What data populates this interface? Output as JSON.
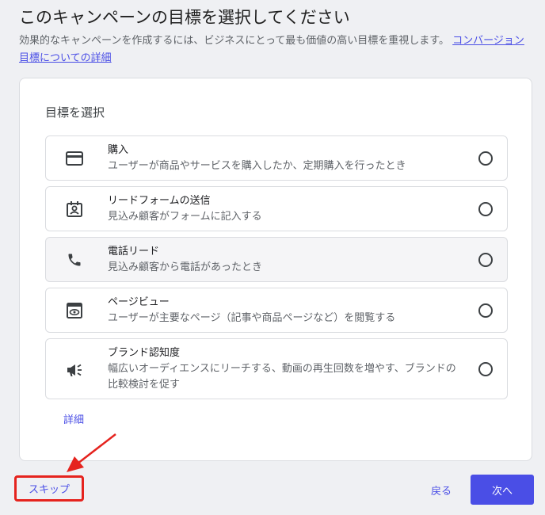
{
  "header": {
    "title": "このキャンペーンの目標を選択してください",
    "description": "効果的なキャンペーンを作成するには、ビジネスにとって最も価値の高い目標を重視します。",
    "link_label": "コンバージョン目標についての詳細"
  },
  "card": {
    "heading": "目標を選択",
    "options": [
      {
        "title": "購入",
        "desc": "ユーザーが商品やサービスを購入したか、定期購入を行ったとき",
        "icon": "credit-card-icon"
      },
      {
        "title": "リードフォームの送信",
        "desc": "見込み顧客がフォームに記入する",
        "icon": "contact-form-icon"
      },
      {
        "title": "電話リード",
        "desc": "見込み顧客から電話があったとき",
        "icon": "phone-icon"
      },
      {
        "title": "ページビュー",
        "desc": "ユーザーが主要なページ（記事や商品ページなど）を閲覧する",
        "icon": "pageview-icon"
      },
      {
        "title": "ブランド認知度",
        "desc": "幅広いオーディエンスにリーチする、動画の再生回数を増やす、ブランドの比較検討を促す",
        "icon": "megaphone-icon"
      }
    ],
    "more_link": "詳細"
  },
  "footer": {
    "skip_label": "スキップ",
    "back_label": "戻る",
    "next_label": "次へ"
  },
  "colors": {
    "accent": "#4a4ee6",
    "annotation": "#e5231e",
    "background": "#eff0f3"
  }
}
